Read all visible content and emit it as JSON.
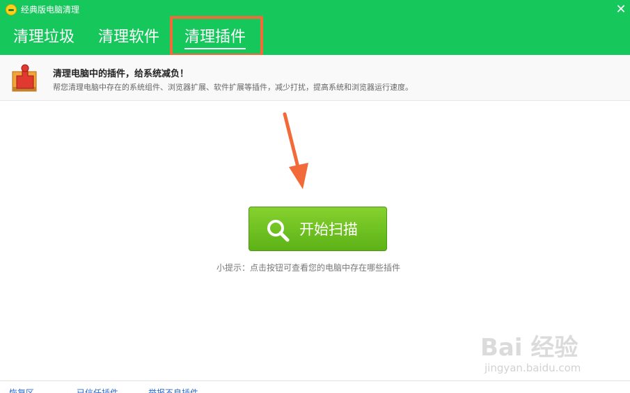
{
  "window": {
    "title": "经典版电脑清理",
    "close_label": "✕"
  },
  "tabs": [
    {
      "label": "清理垃圾",
      "active": false
    },
    {
      "label": "清理软件",
      "active": false
    },
    {
      "label": "清理插件",
      "active": true
    }
  ],
  "info": {
    "heading": "清理电脑中的插件，给系统减负！",
    "description": "帮您清理电脑中存在的系统组件、浏览器扩展、软件扩展等插件，减少打扰，提高系统和浏览器运行速度。"
  },
  "scan": {
    "button_label": "开始扫描",
    "tip": "小提示：点击按钮可查看您的电脑中存在哪些插件"
  },
  "footer": {
    "links": [
      "恢复区",
      "已信任插件",
      "举报不良插件"
    ]
  },
  "watermark": {
    "logo": "Bai 经验",
    "url": "jingyan.baidu.com"
  },
  "colors": {
    "header_green": "#16c75c",
    "button_green": "#6cc020",
    "highlight_orange": "#f26a3a"
  },
  "icons": {
    "app": "app-logo-icon",
    "close": "close-icon",
    "plugin": "puzzle-plugin-icon",
    "search": "search-icon",
    "arrow": "arrow-down-annotation"
  }
}
